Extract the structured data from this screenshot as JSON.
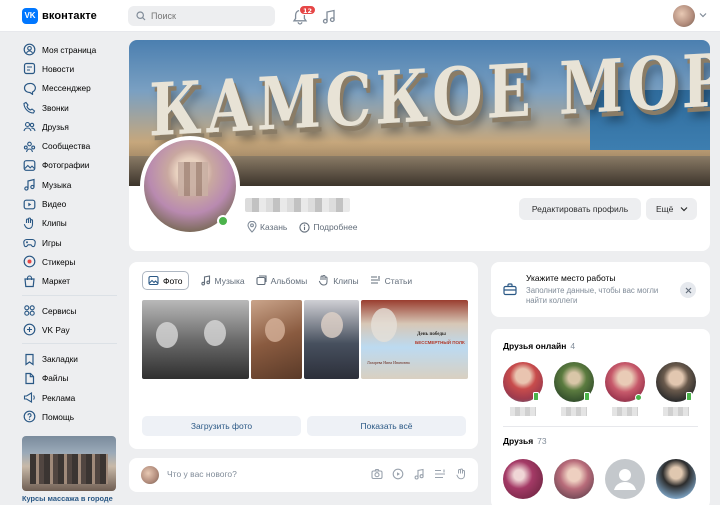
{
  "header": {
    "logo_mark": "VK",
    "logo_text": "вконтакте",
    "search_placeholder": "Поиск",
    "notifications_count": "12"
  },
  "sidebar": {
    "items": [
      {
        "label": "Моя страница",
        "icon": "user-circle-icon"
      },
      {
        "label": "Новости",
        "icon": "newspaper-icon"
      },
      {
        "label": "Мессенджер",
        "icon": "message-icon"
      },
      {
        "label": "Звонки",
        "icon": "phone-icon"
      },
      {
        "label": "Друзья",
        "icon": "users-icon"
      },
      {
        "label": "Сообщества",
        "icon": "communities-icon"
      },
      {
        "label": "Фотографии",
        "icon": "photo-icon"
      },
      {
        "label": "Музыка",
        "icon": "music-icon"
      },
      {
        "label": "Видео",
        "icon": "video-icon"
      },
      {
        "label": "Клипы",
        "icon": "clips-icon"
      },
      {
        "label": "Игры",
        "icon": "gamepad-icon"
      },
      {
        "label": "Стикеры",
        "icon": "sticker-icon"
      },
      {
        "label": "Маркет",
        "icon": "market-icon"
      }
    ],
    "services": [
      {
        "label": "Сервисы",
        "icon": "services-icon"
      },
      {
        "label": "VK Pay",
        "icon": "vkpay-icon"
      }
    ],
    "extra": [
      {
        "label": "Закладки",
        "icon": "bookmark-icon"
      },
      {
        "label": "Файлы",
        "icon": "file-icon"
      },
      {
        "label": "Реклама",
        "icon": "ads-icon"
      },
      {
        "label": "Помощь",
        "icon": "help-icon"
      }
    ],
    "ad_text": "Курсы массажа в городе"
  },
  "profile": {
    "cover_text": "КАМСКОЕ МОРЕ",
    "city": "Казань",
    "details_link": "Подробнее",
    "edit_button": "Редактировать профиль",
    "more_button": "Ещё"
  },
  "media": {
    "tabs": [
      {
        "label": "Фото",
        "icon": "photo-icon"
      },
      {
        "label": "Музыка",
        "icon": "music-icon"
      },
      {
        "label": "Альбомы",
        "icon": "album-icon"
      },
      {
        "label": "Клипы",
        "icon": "clips-icon"
      },
      {
        "label": "Статьи",
        "icon": "article-icon"
      }
    ],
    "upload_button": "Загрузить фото",
    "show_all_button": "Показать всё",
    "poster_title": "День победы",
    "poster_sub": "БЕССМЕРТНЫЙ ПОЛК",
    "poster_name": "Лазарева Нина Ивановна"
  },
  "post": {
    "placeholder": "Что у вас нового?"
  },
  "work": {
    "title": "Укажите место работы",
    "subtitle": "Заполните данные, чтобы вас могли найти коллеги"
  },
  "friends": {
    "online_title": "Друзья онлайн",
    "online_count": "4",
    "all_title": "Друзья",
    "all_count": "73"
  },
  "colors": {
    "accent": "#0077ff",
    "link": "#2a5885",
    "online": "#4bb34b",
    "badge": "#e64646"
  }
}
